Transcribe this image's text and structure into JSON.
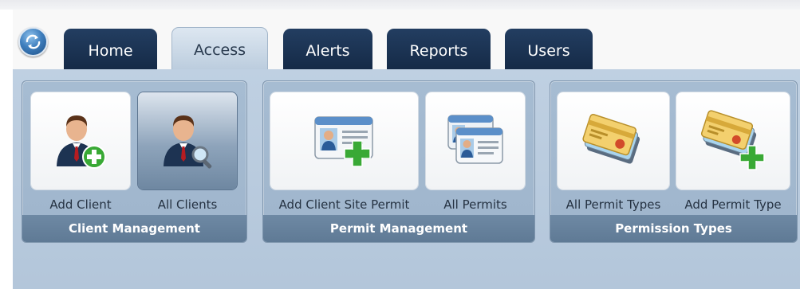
{
  "tabs": [
    {
      "label": "Home",
      "active": false
    },
    {
      "label": "Access",
      "active": true
    },
    {
      "label": "Alerts",
      "active": false
    },
    {
      "label": "Reports",
      "active": false
    },
    {
      "label": "Users",
      "active": false
    }
  ],
  "groups": [
    {
      "caption": "Client Management",
      "buttons": [
        {
          "label": "Add Client",
          "icon": "add-client-icon"
        },
        {
          "label": "All Clients",
          "icon": "search-client-icon",
          "selected": true
        }
      ]
    },
    {
      "caption": "Permit Management",
      "buttons": [
        {
          "label": "Add Client Site Permit",
          "icon": "add-permit-icon"
        },
        {
          "label": "All Permits",
          "icon": "permits-icon"
        }
      ]
    },
    {
      "caption": "Permission Types",
      "buttons": [
        {
          "label": "All Permit Types",
          "icon": "permit-types-icon"
        },
        {
          "label": "Add Permit Type",
          "icon": "add-permit-type-icon"
        }
      ]
    }
  ],
  "colors": {
    "tab_dark": "#1b3454",
    "ribbon_bg": "#b8cadd",
    "group_caption": "#667f99",
    "add_green": "#39a935"
  }
}
